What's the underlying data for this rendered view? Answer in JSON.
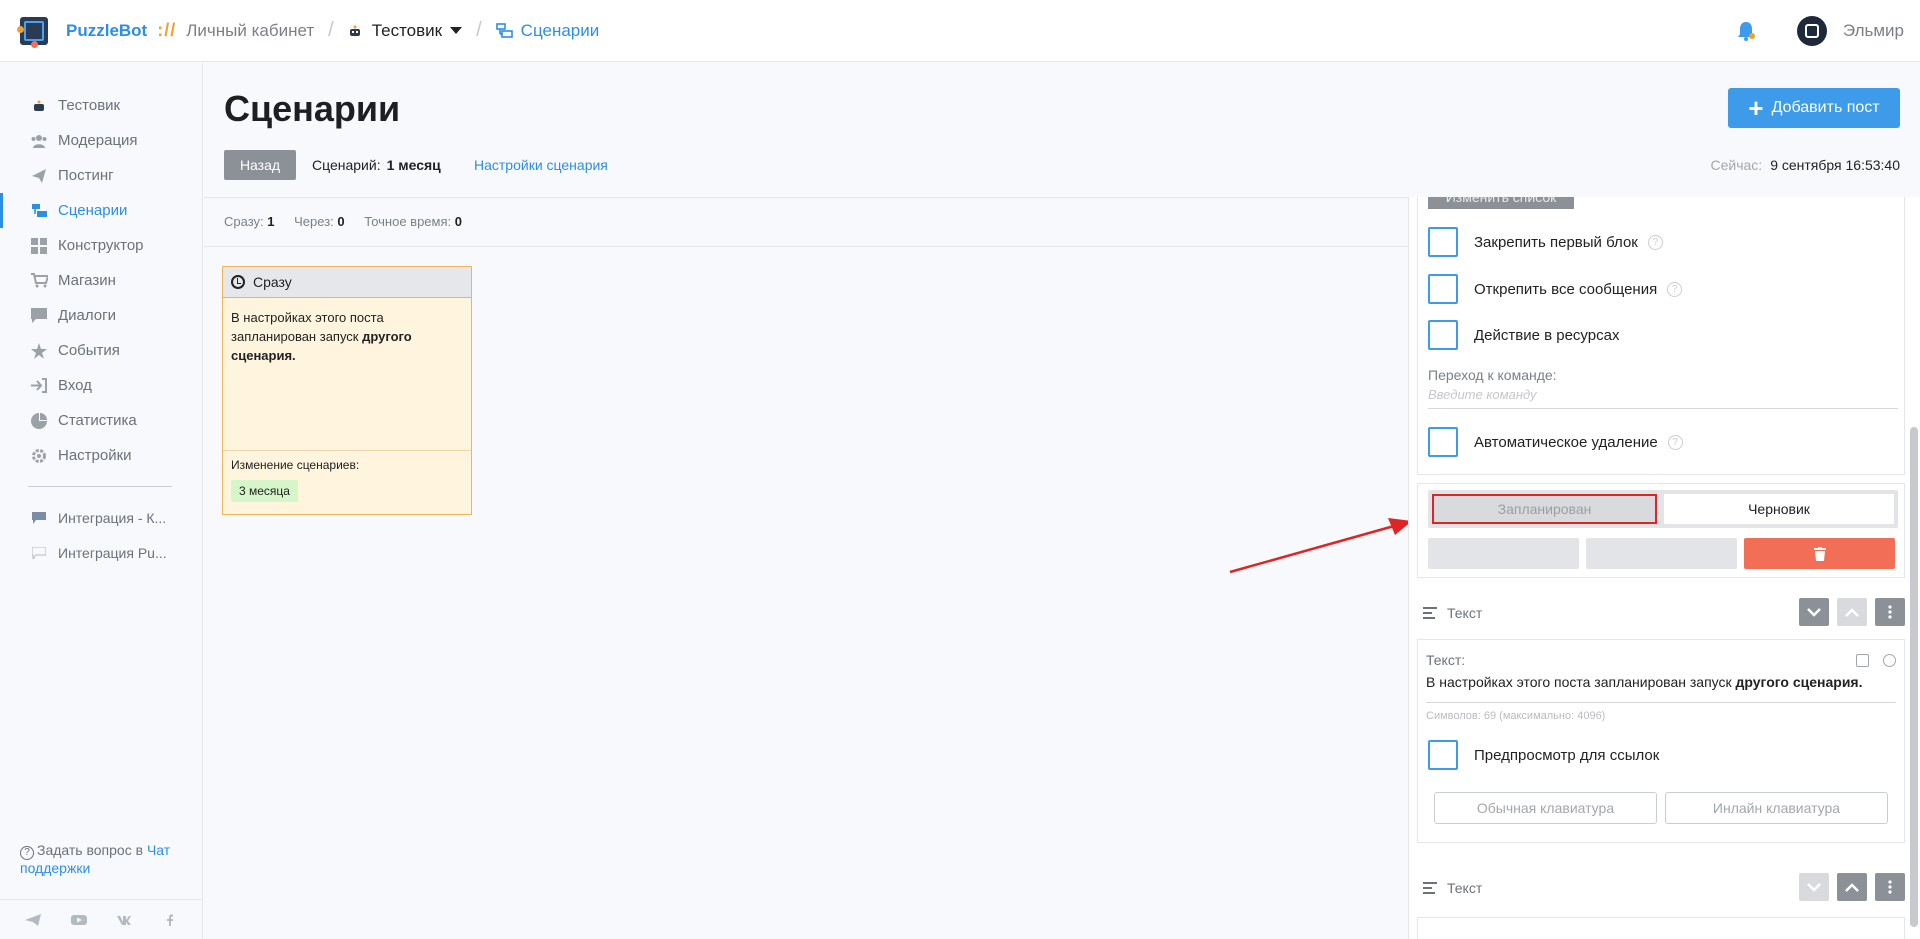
{
  "topbar": {
    "brand": "PuzzleBot",
    "brand_sep": "://",
    "crumb_cabinet": "Личный кабинет",
    "crumb_bot": "Тестовик",
    "crumb_active": "Сценарии",
    "username": "Эльмир"
  },
  "sidebar": {
    "items": [
      {
        "label": "Тестовик",
        "icon": "bot-icon"
      },
      {
        "label": "Модерация",
        "icon": "users-icon"
      },
      {
        "label": "Постинг",
        "icon": "paper-plane-icon"
      },
      {
        "label": "Сценарии",
        "icon": "scenarios-icon"
      },
      {
        "label": "Конструктор",
        "icon": "grid-icon"
      },
      {
        "label": "Магазин",
        "icon": "cart-icon"
      },
      {
        "label": "Диалоги",
        "icon": "chat-icon"
      },
      {
        "label": "События",
        "icon": "star-icon"
      },
      {
        "label": "Вход",
        "icon": "sign-in-icon"
      },
      {
        "label": "Статистика",
        "icon": "pie-chart-icon"
      },
      {
        "label": "Настройки",
        "icon": "gear-icon"
      }
    ],
    "integrations": [
      {
        "label": "Интеграция - К..."
      },
      {
        "label": "Интеграция Pu..."
      }
    ],
    "help_text": "Задать вопрос в",
    "help_link": "Чат поддержки"
  },
  "header": {
    "title": "Сценарии",
    "add_post": "Добавить пост",
    "back": "Назад",
    "scenario_label": "Сценарий:",
    "scenario_value": "1 месяц",
    "scenario_settings": "Настройки сценария",
    "now_label": "Сейчас:",
    "now_value": "9 сентября 16:53:40"
  },
  "stats": {
    "immediate_label": "Сразу:",
    "immediate_value": "1",
    "after_label": "Через:",
    "after_value": "0",
    "exact_label": "Точное время:",
    "exact_value": "0"
  },
  "post_card": {
    "title": "Сразу",
    "text_plain": "В настройках этого поста запланирован запуск",
    "text_bold": "другого сценария.",
    "change_label": "Изменение сценариев:",
    "badge": "3 месяца"
  },
  "right_panel": {
    "change_list": "Изменить список",
    "pin_first": "Закрепить первый блок",
    "unpin_all": "Открепить все сообщения",
    "resource_action": "Действие в ресурсах",
    "jump_label": "Переход к команде:",
    "jump_placeholder": "Введите команду",
    "auto_delete": "Автоматическое удаление",
    "status_planned": "Запланирован",
    "status_draft": "Черновик",
    "block1_title": "Текст",
    "text_label": "Текст:",
    "text_plain": "В настройках этого поста запланирован запуск",
    "text_bold": "другого сценария.",
    "char_count": "Символов: 69 (максимально: 4096)",
    "link_preview": "Предпросмотр для ссылок",
    "kb_regular": "Обычная клавиатура",
    "kb_inline": "Инлайн клавиатура",
    "block2_title": "Текст"
  },
  "colors": {
    "accent": "#3d9be9",
    "highlight": "#e02424",
    "danger": "#f26e57",
    "card_bg": "#fff4dd"
  }
}
